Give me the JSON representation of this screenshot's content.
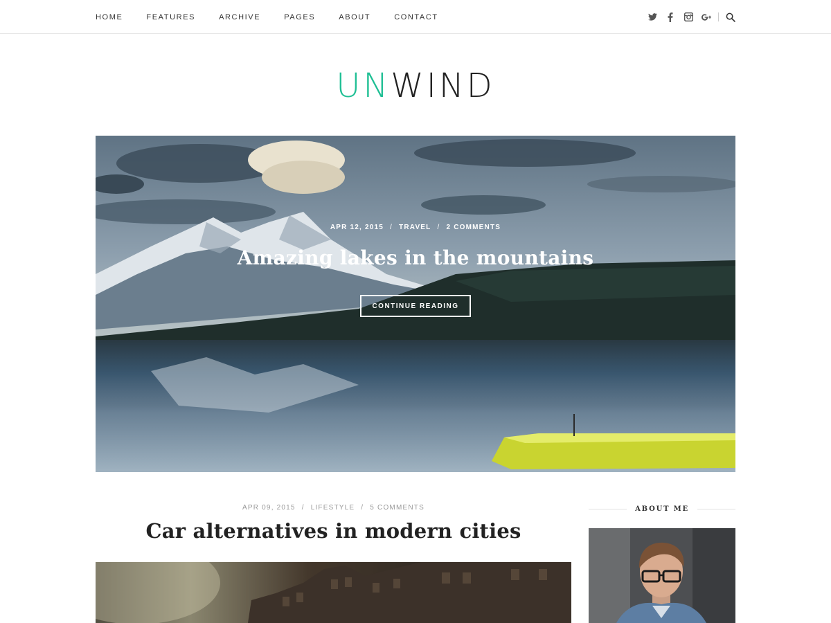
{
  "nav": {
    "items": [
      {
        "label": "HOME"
      },
      {
        "label": "FEATURES"
      },
      {
        "label": "ARCHIVE"
      },
      {
        "label": "PAGES"
      },
      {
        "label": "ABOUT"
      },
      {
        "label": "CONTACT"
      }
    ],
    "social_icons": [
      "twitter-icon",
      "facebook-icon",
      "instagram-icon",
      "google-plus-icon"
    ],
    "search_icon": "search-icon"
  },
  "logo": {
    "accent_text": "UN",
    "rest_text": "WIND",
    "accent_color": "#1fbf94"
  },
  "hero": {
    "date": "APR 12, 2015",
    "category": "TRAVEL",
    "comments": "2 COMMENTS",
    "title": "Amazing lakes in the mountains",
    "button_label": "CONTINUE READING"
  },
  "post": {
    "date": "APR 09, 2015",
    "category": "LIFESTYLE",
    "comments": "5 COMMENTS",
    "title": "Car alternatives in modern cities"
  },
  "sidebar": {
    "widget_title": "ABOUT ME"
  },
  "separators": {
    "slash": "/"
  }
}
